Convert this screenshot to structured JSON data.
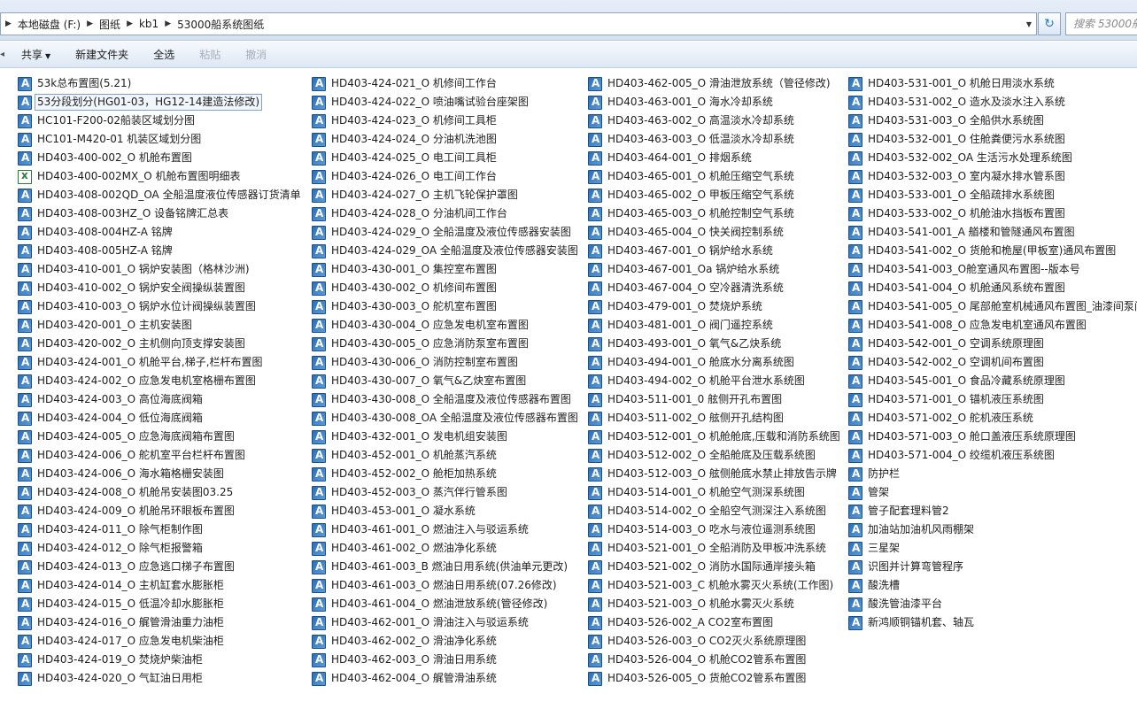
{
  "address": {
    "crumbs": [
      "本地磁盘 (F:)",
      "图纸",
      "kb1",
      "53000船系统图纸"
    ],
    "search_placeholder": "搜索 53000船..."
  },
  "toolbar": {
    "share": "共享",
    "new_folder": "新建文件夹",
    "select_all": "全选",
    "paste": "粘贴",
    "undo": "撤消"
  },
  "columns": [
    [
      {
        "name": "53k总布置图(5.21)",
        "icon": "autocad"
      },
      {
        "name": "53分段划分(HG01-03，HG12-14建造法修改)",
        "icon": "autocad",
        "selected": true
      },
      {
        "name": "HC101-F200-02船装区域划分图",
        "icon": "autocad"
      },
      {
        "name": "HC101-M420-01 机装区域划分图",
        "icon": "autocad"
      },
      {
        "name": "HD403-400-002_O 机舱布置图",
        "icon": "autocad"
      },
      {
        "name": "HD403-400-002MX_O 机舱布置图明细表",
        "icon": "excel"
      },
      {
        "name": "HD403-408-002QD_OA 全船温度液位传感器订货清单",
        "icon": "autocad"
      },
      {
        "name": "HD403-408-003HZ_O 设备铭牌汇总表",
        "icon": "autocad"
      },
      {
        "name": "HD403-408-004HZ-A 铭牌",
        "icon": "autocad"
      },
      {
        "name": "HD403-408-005HZ-A 铭牌",
        "icon": "autocad"
      },
      {
        "name": "HD403-410-001_O 锅炉安装图（格林沙洲)",
        "icon": "autocad"
      },
      {
        "name": "HD403-410-002_O 锅炉安全阀操纵装置图",
        "icon": "autocad"
      },
      {
        "name": "HD403-410-003_O 锅炉水位计阀操纵装置图",
        "icon": "autocad"
      },
      {
        "name": "HD403-420-001_O 主机安装图",
        "icon": "autocad"
      },
      {
        "name": "HD403-420-002_O 主机侧向顶支撑安装图",
        "icon": "autocad"
      },
      {
        "name": "HD403-424-001_O 机舱平台,梯子,栏杆布置图",
        "icon": "autocad"
      },
      {
        "name": "HD403-424-002_O 应急发电机室格栅布置图",
        "icon": "autocad"
      },
      {
        "name": "HD403-424-003_O 高位海底阀箱",
        "icon": "autocad"
      },
      {
        "name": "HD403-424-004_O 低位海底阀箱",
        "icon": "autocad"
      },
      {
        "name": "HD403-424-005_O 应急海底阀箱布置图",
        "icon": "autocad"
      },
      {
        "name": "HD403-424-006_O 舵机室平台栏杆布置图",
        "icon": "autocad"
      },
      {
        "name": "HD403-424-006_O 海水箱格栅安装图",
        "icon": "autocad"
      },
      {
        "name": "HD403-424-008_O 机舱吊安装图03.25",
        "icon": "autocad"
      },
      {
        "name": "HD403-424-009_O 机舱吊环眼板布置图",
        "icon": "autocad"
      },
      {
        "name": "HD403-424-011_O 除气柜制作图",
        "icon": "autocad"
      },
      {
        "name": "HD403-424-012_O 除气柜报警箱",
        "icon": "autocad"
      },
      {
        "name": "HD403-424-013_O 应急逃口梯子布置图",
        "icon": "autocad"
      },
      {
        "name": "HD403-424-014_O 主机缸套水膨胀柜",
        "icon": "autocad"
      },
      {
        "name": "HD403-424-015_O 低温冷却水膨胀柜",
        "icon": "autocad"
      },
      {
        "name": "HD403-424-016_O 艉管滑油重力油柜",
        "icon": "autocad"
      },
      {
        "name": "HD403-424-017_O 应急发电机柴油柜",
        "icon": "autocad"
      },
      {
        "name": "HD403-424-019_O 焚烧炉柴油柜",
        "icon": "autocad"
      },
      {
        "name": "HD403-424-020_O 气缸油日用柜",
        "icon": "autocad"
      }
    ],
    [
      {
        "name": "HD403-424-021_O 机修间工作台",
        "icon": "autocad"
      },
      {
        "name": "HD403-424-022_O 喷油嘴试验台座架图",
        "icon": "autocad"
      },
      {
        "name": "HD403-424-023_O 机修间工具柜",
        "icon": "autocad"
      },
      {
        "name": "HD403-424-024_O 分油机洗池图",
        "icon": "autocad"
      },
      {
        "name": "HD403-424-025_O 电工间工具柜",
        "icon": "autocad"
      },
      {
        "name": "HD403-424-026_O 电工间工作台",
        "icon": "autocad"
      },
      {
        "name": "HD403-424-027_O 主机飞轮保护罩图",
        "icon": "autocad"
      },
      {
        "name": "HD403-424-028_O 分油机间工作台",
        "icon": "autocad"
      },
      {
        "name": "HD403-424-029_O 全船温度及液位传感器安装图",
        "icon": "autocad"
      },
      {
        "name": "HD403-424-029_OA 全船温度及液位传感器安装图",
        "icon": "autocad"
      },
      {
        "name": "HD403-430-001_O 集控室布置图",
        "icon": "autocad"
      },
      {
        "name": "HD403-430-002_O 机修间布置图",
        "icon": "autocad"
      },
      {
        "name": "HD403-430-003_O 舵机室布置图",
        "icon": "autocad"
      },
      {
        "name": "HD403-430-004_O 应急发电机室布置图",
        "icon": "autocad"
      },
      {
        "name": "HD403-430-005_O 应急消防泵室布置图",
        "icon": "autocad"
      },
      {
        "name": "HD403-430-006_O 消防控制室布置图",
        "icon": "autocad"
      },
      {
        "name": "HD403-430-007_O 氧气&乙炔室布置图",
        "icon": "autocad"
      },
      {
        "name": "HD403-430-008_O 全船温度及液位传感器布置图",
        "icon": "autocad"
      },
      {
        "name": "HD403-430-008_OA 全船温度及液位传感器布置图",
        "icon": "autocad"
      },
      {
        "name": "HD403-432-001_O 发电机组安装图",
        "icon": "autocad"
      },
      {
        "name": "HD403-452-001_O 机舱蒸汽系统",
        "icon": "autocad"
      },
      {
        "name": "HD403-452-002_O 舱柜加热系统",
        "icon": "autocad"
      },
      {
        "name": "HD403-452-003_O 蒸汽伴行管系图",
        "icon": "autocad"
      },
      {
        "name": "HD403-453-001_O 凝水系统",
        "icon": "autocad"
      },
      {
        "name": "HD403-461-001_O 燃油注入与驳运系统",
        "icon": "autocad"
      },
      {
        "name": "HD403-461-002_O 燃油净化系统",
        "icon": "autocad"
      },
      {
        "name": "HD403-461-003_B 燃油日用系统(供油单元更改)",
        "icon": "autocad"
      },
      {
        "name": "HD403-461-003_O 燃油日用系统(07.26修改)",
        "icon": "autocad"
      },
      {
        "name": "HD403-461-004_O 燃油泄放系统(管径修改)",
        "icon": "autocad"
      },
      {
        "name": "HD403-462-001_O 滑油注入与驳运系统",
        "icon": "autocad"
      },
      {
        "name": "HD403-462-002_O 滑油净化系统",
        "icon": "autocad"
      },
      {
        "name": "HD403-462-003_O 滑油日用系统",
        "icon": "autocad"
      },
      {
        "name": "HD403-462-004_O 艉管滑油系统",
        "icon": "autocad"
      }
    ],
    [
      {
        "name": "HD403-462-005_O 滑油泄放系统（管径修改)",
        "icon": "autocad"
      },
      {
        "name": "HD403-463-001_O 海水冷却系统",
        "icon": "autocad"
      },
      {
        "name": "HD403-463-002_O 高温淡水冷却系统",
        "icon": "autocad"
      },
      {
        "name": "HD403-463-003_O 低温淡水冷却系统",
        "icon": "autocad"
      },
      {
        "name": "HD403-464-001_O 排烟系统",
        "icon": "autocad"
      },
      {
        "name": "HD403-465-001_O 机舱压缩空气系统",
        "icon": "autocad"
      },
      {
        "name": "HD403-465-002_O 甲板压缩空气系统",
        "icon": "autocad"
      },
      {
        "name": "HD403-465-003_O 机舱控制空气系统",
        "icon": "autocad"
      },
      {
        "name": "HD403-465-004_O 快关阀控制系统",
        "icon": "autocad"
      },
      {
        "name": "HD403-467-001_O 锅炉给水系统",
        "icon": "autocad"
      },
      {
        "name": "HD403-467-001_Oa 锅炉给水系统",
        "icon": "autocad"
      },
      {
        "name": "HD403-467-004_O 空冷器清洗系统",
        "icon": "autocad"
      },
      {
        "name": "HD403-479-001_O 焚烧炉系统",
        "icon": "autocad"
      },
      {
        "name": "HD403-481-001_O 阀门遥控系统",
        "icon": "autocad"
      },
      {
        "name": "HD403-493-001_O 氧气&乙炔系统",
        "icon": "autocad"
      },
      {
        "name": "HD403-494-001_O 舱底水分离系统图",
        "icon": "autocad"
      },
      {
        "name": "HD403-494-002_O 机舱平台泄水系统图",
        "icon": "autocad"
      },
      {
        "name": "HD403-511-001_0 舷侧开孔布置图",
        "icon": "autocad"
      },
      {
        "name": "HD403-511-002_O 舷侧开孔结构图",
        "icon": "autocad"
      },
      {
        "name": "HD403-512-001_O 机舱舱底,压载和消防系统图",
        "icon": "autocad"
      },
      {
        "name": "HD403-512-002_O 全船舱底及压载系统图",
        "icon": "autocad"
      },
      {
        "name": "HD403-512-003_O 舷侧舱底水禁止排放告示牌",
        "icon": "autocad"
      },
      {
        "name": "HD403-514-001_O 机舱空气测深系统图",
        "icon": "autocad"
      },
      {
        "name": "HD403-514-002_O 全船空气测深注入系统图",
        "icon": "autocad"
      },
      {
        "name": "HD403-514-003_O 吃水与液位遥测系统图",
        "icon": "autocad"
      },
      {
        "name": "HD403-521-001_O 全船消防及甲板冲洗系统",
        "icon": "autocad"
      },
      {
        "name": "HD403-521-002_O 消防水国际通岸接头箱",
        "icon": "autocad"
      },
      {
        "name": "HD403-521-003_C 机舱水雾灭火系统(工作图)",
        "icon": "autocad"
      },
      {
        "name": "HD403-521-003_O 机舱水雾灭火系统",
        "icon": "autocad"
      },
      {
        "name": "HD403-526-002_A CO2室布置图",
        "icon": "autocad"
      },
      {
        "name": "HD403-526-003_O CO2灭火系统原理图",
        "icon": "autocad"
      },
      {
        "name": "HD403-526-004_O 机舱CO2管系布置图",
        "icon": "autocad"
      },
      {
        "name": "HD403-526-005_O 货舱CO2管系布置图",
        "icon": "autocad"
      }
    ],
    [
      {
        "name": "HD403-531-001_O 机舱日用淡水系统",
        "icon": "autocad"
      },
      {
        "name": "HD403-531-002_O 造水及淡水注入系统",
        "icon": "autocad"
      },
      {
        "name": "HD403-531-003_O 全船供水系统图",
        "icon": "autocad"
      },
      {
        "name": "HD403-532-001_O 住舱粪便污水系统图",
        "icon": "autocad"
      },
      {
        "name": "HD403-532-002_OA 生活污水处理系统图",
        "icon": "autocad"
      },
      {
        "name": "HD403-532-003_O 室内凝水排水管系图",
        "icon": "autocad"
      },
      {
        "name": "HD403-533-001_O 全船疏排水系统图",
        "icon": "autocad"
      },
      {
        "name": "HD403-533-002_O 机舱油水挡板布置图",
        "icon": "autocad"
      },
      {
        "name": "HD403-541-001_A 艏楼和管隧通风布置图",
        "icon": "autocad"
      },
      {
        "name": "HD403-541-002_O 货舱和桅屋(甲板室)通风布置图",
        "icon": "autocad"
      },
      {
        "name": "HD403-541-003_O舱室通风布置图--版本号",
        "icon": "autocad"
      },
      {
        "name": "HD403-541-004_O 机舱通风系统布置图",
        "icon": "autocad"
      },
      {
        "name": "HD403-541-005_O 尾部舱室机械通风布置图_油漆间泵间",
        "icon": "autocad"
      },
      {
        "name": "HD403-541-008_O 应急发电机室通风布置图",
        "icon": "autocad"
      },
      {
        "name": "HD403-542-001_O 空调系统原理图",
        "icon": "autocad"
      },
      {
        "name": "HD403-542-002_O 空调机间布置图",
        "icon": "autocad"
      },
      {
        "name": "HD403-545-001_O 食品冷藏系统原理图",
        "icon": "autocad"
      },
      {
        "name": "HD403-571-001_O 锚机液压系统图",
        "icon": "autocad"
      },
      {
        "name": "HD403-571-002_O 舵机液压系统",
        "icon": "autocad"
      },
      {
        "name": "HD403-571-003_O 舱口盖液压系统原理图",
        "icon": "autocad"
      },
      {
        "name": "HD403-571-004_O 绞缆机液压系统图",
        "icon": "autocad"
      },
      {
        "name": "防护栏",
        "icon": "autocad"
      },
      {
        "name": "管架",
        "icon": "autocad"
      },
      {
        "name": "管子配套理料管2",
        "icon": "autocad"
      },
      {
        "name": "加油站加油机风雨棚架",
        "icon": "autocad"
      },
      {
        "name": "三星架",
        "icon": "autocad"
      },
      {
        "name": "识图并计算弯管程序",
        "icon": "autocad"
      },
      {
        "name": "酸洗槽",
        "icon": "autocad"
      },
      {
        "name": "酸洗管油漆平台",
        "icon": "autocad"
      },
      {
        "name": "新鸿顺铜锚机套、轴瓦",
        "icon": "autocad"
      }
    ]
  ]
}
